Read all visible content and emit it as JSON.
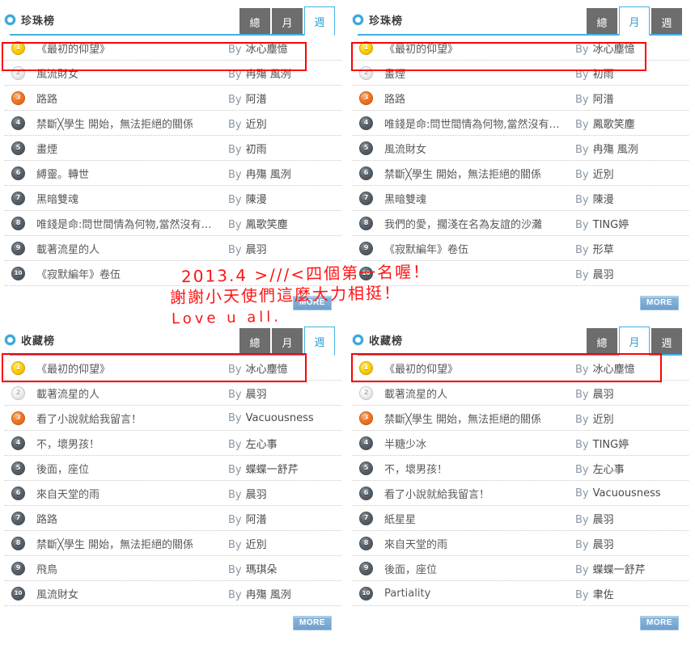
{
  "colors": {
    "accent": "#45b0e3",
    "tab_inactive_bg": "#6d6d6d",
    "tab_active_text": "#2e9fd4",
    "annotation_red": "#ff1414",
    "more_button": "#7aa8cf",
    "rank1_gold": "#fcd211",
    "rank2_silver": "#e2e2e2",
    "rank3_bronze": "#f2782a",
    "rank_default": "#5b646c"
  },
  "by_label": "By",
  "more_label": "MORE",
  "annotation": {
    "line1": "2013.4  >///<四個第一名喔！",
    "line2": "謝謝小天使們這麼大力相挺！",
    "line3": "Love u all."
  },
  "panels": [
    {
      "id": "pearl-week",
      "title": "珍珠榜",
      "icon": "ring-icon",
      "tabs": [
        {
          "label": "總",
          "active": false
        },
        {
          "label": "月",
          "active": false
        },
        {
          "label": "週",
          "active": true
        }
      ],
      "more_label": "MORE",
      "rows": [
        {
          "rank": "1",
          "title": "《最初的仰望》",
          "author": "冰心塵憶",
          "highlighted": true
        },
        {
          "rank": "2",
          "title": "風流財女",
          "author": "冉殤 風洌",
          "highlighted": false
        },
        {
          "rank": "3",
          "title": "路路",
          "author": "阿潽",
          "highlighted": false
        },
        {
          "rank": "4",
          "title": "禁斷╳學生 開始，無法拒絕的關係",
          "author": "近別",
          "highlighted": false
        },
        {
          "rank": "5",
          "title": "畫煙",
          "author": "初雨",
          "highlighted": false
        },
        {
          "rank": "6",
          "title": "縛靈。轉世",
          "author": "冉殤 風洌",
          "highlighted": false
        },
        {
          "rank": "7",
          "title": "黑暗雙魂",
          "author": "陳漫",
          "highlighted": false
        },
        {
          "rank": "8",
          "title": "唯錢是命:問世間情為何物,當然沒有錢重",
          "author": "鳳歌笑塵",
          "highlighted": false
        },
        {
          "rank": "9",
          "title": "載著流星的人",
          "author": "晨羽",
          "highlighted": false
        },
        {
          "rank": "10",
          "title": "《寂默編年》卷伍",
          "author": "",
          "highlighted": false
        }
      ]
    },
    {
      "id": "pearl-month",
      "title": "珍珠榜",
      "icon": "ring-icon",
      "tabs": [
        {
          "label": "總",
          "active": false
        },
        {
          "label": "月",
          "active": true
        },
        {
          "label": "週",
          "active": false
        }
      ],
      "more_label": "MORE",
      "rows": [
        {
          "rank": "1",
          "title": "《最初的仰望》",
          "author": "冰心塵憶",
          "highlighted": true
        },
        {
          "rank": "2",
          "title": "畫煙",
          "author": "初雨",
          "highlighted": false
        },
        {
          "rank": "3",
          "title": "路路",
          "author": "阿潽",
          "highlighted": false
        },
        {
          "rank": "4",
          "title": "唯錢是命:問世間情為何物,當然沒有錢重",
          "author": "鳳歌笑塵",
          "highlighted": false
        },
        {
          "rank": "5",
          "title": "風流財女",
          "author": "冉殤 風洌",
          "highlighted": false
        },
        {
          "rank": "6",
          "title": "禁斷╳學生 開始，無法拒絕的關係",
          "author": "近別",
          "highlighted": false
        },
        {
          "rank": "7",
          "title": "黑暗雙魂",
          "author": "陳漫",
          "highlighted": false
        },
        {
          "rank": "8",
          "title": "我們的愛，擱淺在名為友誼的沙灘",
          "author": "TING婷",
          "highlighted": false
        },
        {
          "rank": "9",
          "title": "《寂默編年》卷伍",
          "author": "形草",
          "highlighted": false
        },
        {
          "rank": "10",
          "title": "",
          "author": "晨羽",
          "highlighted": false
        }
      ]
    },
    {
      "id": "favorite-week",
      "title": "收藏榜",
      "icon": "ring-icon",
      "tabs": [
        {
          "label": "總",
          "active": false
        },
        {
          "label": "月",
          "active": false
        },
        {
          "label": "週",
          "active": true
        }
      ],
      "more_label": "MORE",
      "rows": [
        {
          "rank": "1",
          "title": "《最初的仰望》",
          "author": "冰心塵憶",
          "highlighted": true
        },
        {
          "rank": "2",
          "title": "載著流星的人",
          "author": "晨羽",
          "highlighted": false
        },
        {
          "rank": "3",
          "title": "看了小說就給我留言！",
          "author": "Vacuousness",
          "highlighted": false
        },
        {
          "rank": "4",
          "title": "不，壞男孩！",
          "author": "左心事",
          "highlighted": false
        },
        {
          "rank": "5",
          "title": "後面，座位",
          "author": "蝶蝶一舒芹",
          "highlighted": false
        },
        {
          "rank": "6",
          "title": "來自天堂的雨",
          "author": "晨羽",
          "highlighted": false
        },
        {
          "rank": "7",
          "title": "路路",
          "author": "阿潽",
          "highlighted": false
        },
        {
          "rank": "8",
          "title": "禁斷╳學生 開始，無法拒絕的關係",
          "author": "近別",
          "highlighted": false
        },
        {
          "rank": "9",
          "title": "飛鳥",
          "author": "瑪琪朵",
          "highlighted": false
        },
        {
          "rank": "10",
          "title": "風流財女",
          "author": "冉殤 風洌",
          "highlighted": false
        }
      ]
    },
    {
      "id": "favorite-month",
      "title": "收藏榜",
      "icon": "ring-icon",
      "tabs": [
        {
          "label": "總",
          "active": false
        },
        {
          "label": "月",
          "active": true
        },
        {
          "label": "週",
          "active": false
        }
      ],
      "more_label": "MORE",
      "rows": [
        {
          "rank": "1",
          "title": "《最初的仰望》",
          "author": "冰心塵憶",
          "highlighted": true
        },
        {
          "rank": "2",
          "title": "載著流星的人",
          "author": "晨羽",
          "highlighted": false
        },
        {
          "rank": "3",
          "title": "禁斷╳學生 開始，無法拒絕的關係",
          "author": "近別",
          "highlighted": false
        },
        {
          "rank": "4",
          "title": "半糖少冰",
          "author": "TING婷",
          "highlighted": false
        },
        {
          "rank": "5",
          "title": "不，壞男孩！",
          "author": "左心事",
          "highlighted": false
        },
        {
          "rank": "6",
          "title": "看了小說就給我留言！",
          "author": "Vacuousness",
          "highlighted": false
        },
        {
          "rank": "7",
          "title": "紙星星",
          "author": "晨羽",
          "highlighted": false
        },
        {
          "rank": "8",
          "title": "來自天堂的雨",
          "author": "晨羽",
          "highlighted": false
        },
        {
          "rank": "9",
          "title": "後面，座位",
          "author": "蝶蝶一舒芹",
          "highlighted": false
        },
        {
          "rank": "10",
          "title": "Partiality",
          "author": "聿佐",
          "highlighted": false
        }
      ]
    }
  ]
}
